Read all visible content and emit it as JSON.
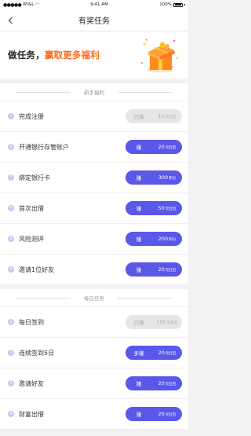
{
  "status_bar": {
    "carrier": "RY&L",
    "time": "9:41 AM",
    "battery": "100%"
  },
  "nav": {
    "title": "有奖任务"
  },
  "banner": {
    "text_plain": "做任务，",
    "text_highlight": "赢取更多福利"
  },
  "colors": {
    "accent": "#5b57e8",
    "highlight": "#ff6a1a",
    "badge": "#c9c7f3",
    "done": "#e6e6e6"
  },
  "sections": [
    {
      "title": "新手福利",
      "tasks": [
        {
          "num": "1",
          "label": "完成注册",
          "action": "已赚",
          "amount": "10",
          "unit": "元红包",
          "done": true
        },
        {
          "num": "2",
          "label": "开通银行存管账户",
          "action": "赚",
          "amount": "20",
          "unit": "元红包",
          "done": false
        },
        {
          "num": "3",
          "label": "绑定银行卡",
          "action": "赚",
          "amount": "300",
          "unit": "积分",
          "done": false
        },
        {
          "num": "4",
          "label": "首次出借",
          "action": "赚",
          "amount": "50",
          "unit": "元红包",
          "done": false
        },
        {
          "num": "5",
          "label": "风险测评",
          "action": "赚",
          "amount": "200",
          "unit": "积分",
          "done": false
        },
        {
          "num": "6",
          "label": "邀请1位好友",
          "action": "赚",
          "amount": "20",
          "unit": "元红包",
          "done": false
        }
      ]
    },
    {
      "title": "每日任务",
      "tasks": [
        {
          "num": "1",
          "label": "每日签到",
          "action": "已赚",
          "amount": "100",
          "unit": "元红包",
          "done": true
        },
        {
          "num": "2",
          "label": "连续签到5日",
          "action": "多赚",
          "amount": "20",
          "unit": "元红包",
          "done": false
        },
        {
          "num": "3",
          "label": "邀请好友",
          "action": "赚",
          "amount": "20",
          "unit": "元红包",
          "done": false
        },
        {
          "num": "4",
          "label": "财富出借",
          "action": "赚",
          "amount": "20",
          "unit": "元红包",
          "done": false
        }
      ]
    }
  ]
}
